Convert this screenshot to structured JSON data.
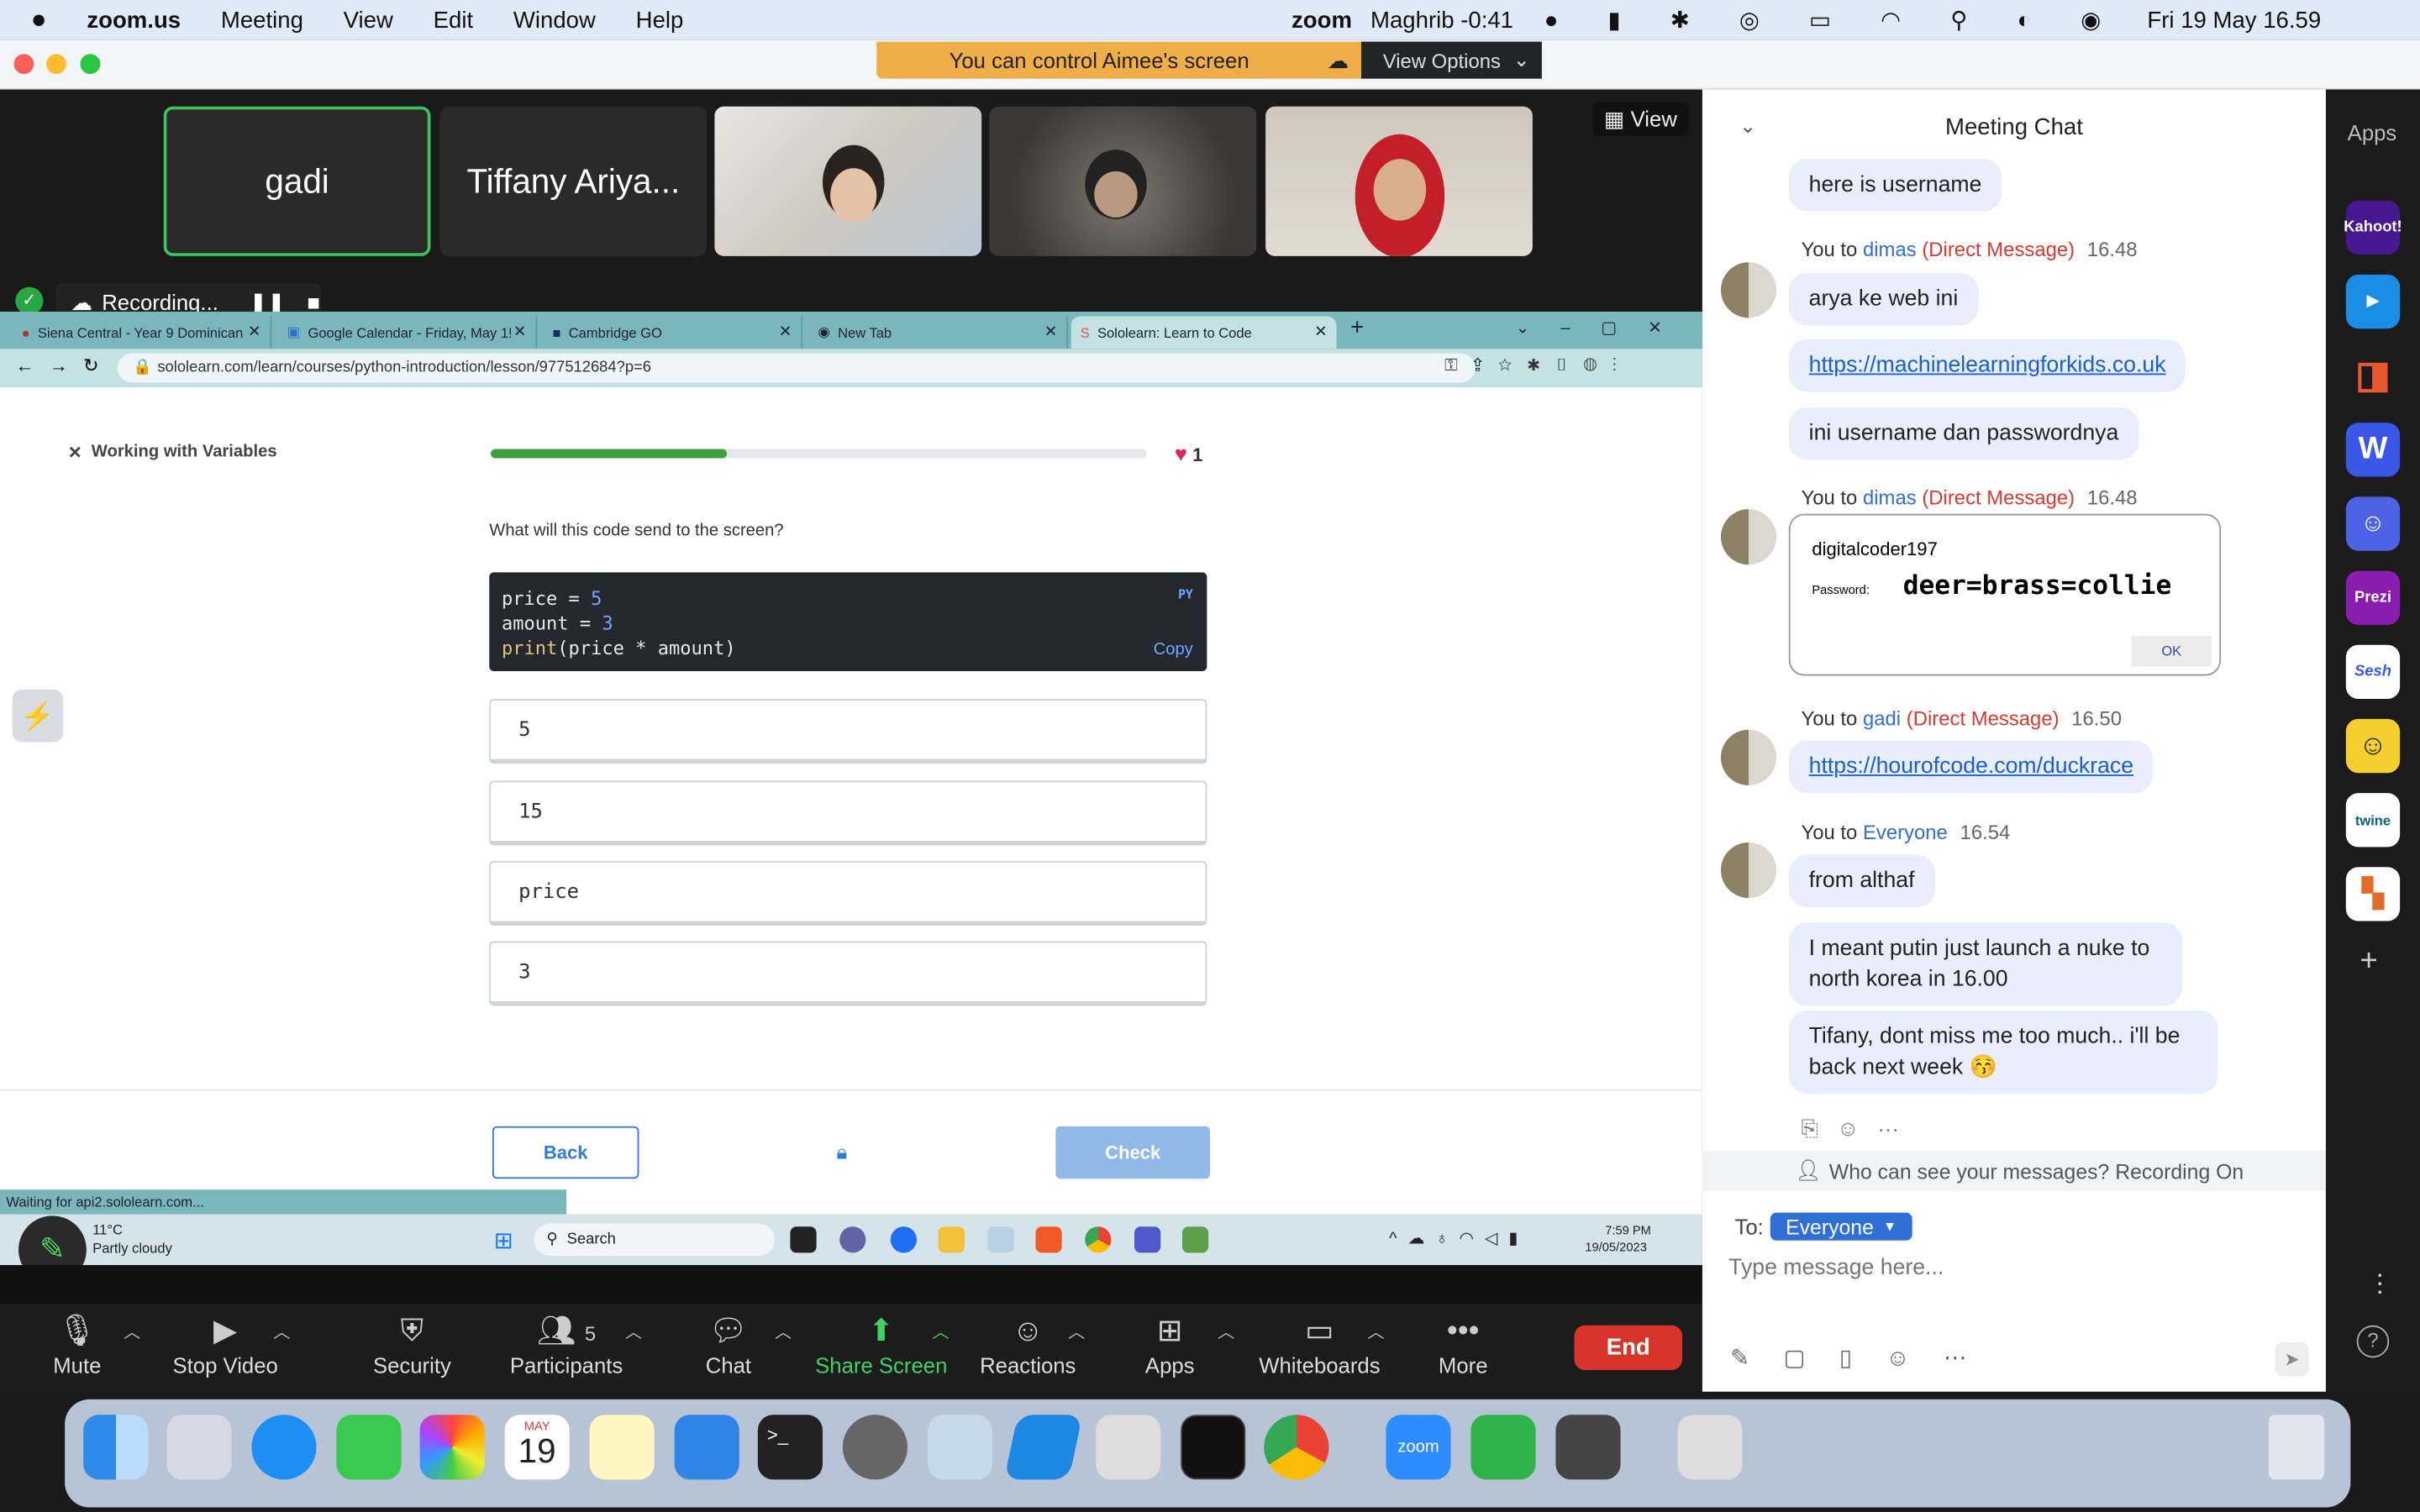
{
  "menubar": {
    "app": "zoom.us",
    "items": [
      "Meeting",
      "View",
      "Edit",
      "Window",
      "Help"
    ],
    "zoom_logo": "zoom",
    "prayer": "Maghrib -0:41",
    "datetime": "Fri 19 May  16.59"
  },
  "banner": {
    "text": "You can control Aimee's screen",
    "view_options": "View Options"
  },
  "gallery": {
    "tiles": [
      "gadi",
      "Tiffany Ariya..."
    ],
    "view": "View"
  },
  "recording": {
    "label": "Recording..."
  },
  "browser": {
    "tabs": [
      "Siena Central - Year 9 Dominican",
      "Google Calendar - Friday, May 1!",
      "Cambridge GO",
      "New Tab",
      "Sololearn: Learn to Code"
    ],
    "url": "sololearn.com/learn/courses/python-introduction/lesson/977512684?p=6",
    "status": "Waiting for api2.sololearn.com..."
  },
  "lesson": {
    "title": "Working with Variables",
    "progress_percent": 36,
    "lives": "1",
    "question": "What will this code send to the screen?",
    "code_lang": "PY",
    "copy": "Copy",
    "code": {
      "l1a": "price = ",
      "l1b": "5",
      "l2a": "amount = ",
      "l2b": "3",
      "l3a": "print",
      "l3b": "(price * amount)"
    },
    "options": [
      "5",
      "15",
      "price",
      "3"
    ],
    "back": "Back",
    "check": "Check"
  },
  "taskbar": {
    "weather_temp": "11°C",
    "weather": "Partly cloudy",
    "search": "Search",
    "time": "7:59 PM",
    "date": "19/05/2023"
  },
  "toolbar": {
    "items": [
      "Mute",
      "Stop Video",
      "Security",
      "Participants",
      "Chat",
      "Share Screen",
      "Reactions",
      "Apps",
      "Whiteboards",
      "More"
    ],
    "participants_count": "5",
    "end": "End"
  },
  "chat": {
    "title": "Meeting Chat",
    "m0": "here is username",
    "h1": {
      "you": "You to ",
      "who": "dimas",
      "dm": "(Direct Message)",
      "time": "16.48"
    },
    "m1": "arya ke web ini",
    "m2": "https://machinelearningforkids.co.uk",
    "m3": "ini username dan passwordnya",
    "h2": {
      "you": "You to ",
      "who": "dimas",
      "dm": "(Direct Message)",
      "time": "16.48"
    },
    "img": {
      "username": "digitalcoder197",
      "pw_label": "Password:",
      "password": "deer=brass=collie",
      "ok": "OK"
    },
    "h3": {
      "you": "You to ",
      "who": "gadi",
      "dm": "(Direct Message)",
      "time": "16.50"
    },
    "m4": "https://hourofcode.com/duckrace",
    "h4": {
      "you": "You to ",
      "who": "Everyone",
      "time": "16.54"
    },
    "m5": "from althaf",
    "m6": "I meant putin just launch a nuke to north korea in 16.00",
    "m7": "Tifany, dont miss me too much.. i'll be back next week 😚",
    "notice": "Who can see your messages? Recording On",
    "to_label": "To:",
    "to_value": "Everyone",
    "placeholder": "Type message here..."
  },
  "apps": {
    "title": "Apps",
    "list": [
      "Kahoot!",
      "Prezi",
      "Sesh",
      "twine"
    ]
  },
  "dock": {
    "calendar_month": "MAY",
    "calendar_day": "19",
    "zoom": "zoom"
  },
  "colors": {
    "zoom_green": "#22c55e",
    "end_red": "#d9342b",
    "banner": "#efae48",
    "sololearn_progress": "#3ca03c",
    "link": "#1a5fd1"
  }
}
